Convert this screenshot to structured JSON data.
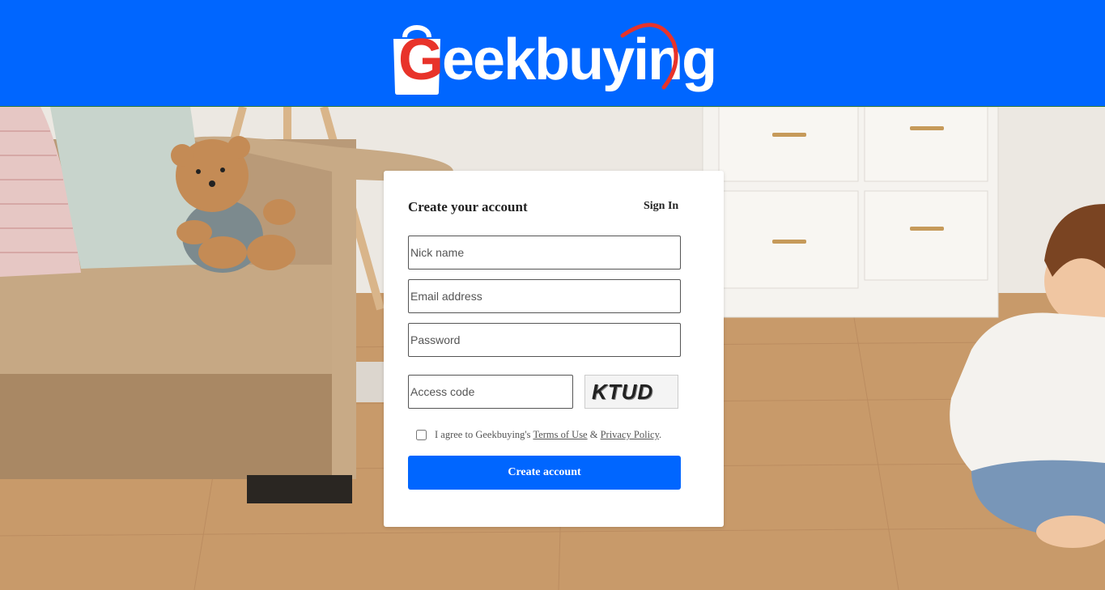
{
  "header": {
    "brand": "Geekbuying",
    "brand_first_letter": "G",
    "brand_rest": "eekbuying",
    "brand_color": "#0066ff",
    "logo_accent_color": "#e8332a"
  },
  "form": {
    "title": "Create your account",
    "signin_label": "Sign In",
    "nick_placeholder": "Nick name",
    "email_placeholder": "Email address",
    "password_placeholder": "Password",
    "access_code_placeholder": "Access code",
    "captcha_text": "KTUD",
    "agree_prefix": "I agree to Geekbuying's ",
    "terms_label": "Terms of Use",
    "agree_and": " & ",
    "privacy_label": "Privacy Policy",
    "agree_suffix": ".",
    "submit_label": "Create account"
  },
  "icons": {
    "logo": "shopping-bag-icon"
  }
}
